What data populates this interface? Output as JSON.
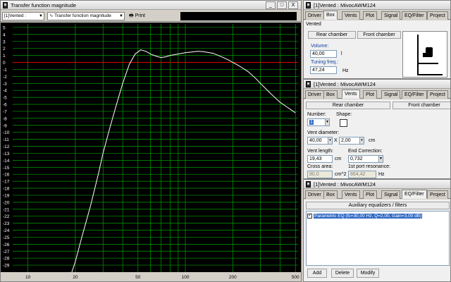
{
  "graph_window": {
    "title": "Transfer function magnitude",
    "toolbar": {
      "project_select": "[1]Vented :",
      "plot_select": "Transfer function magnitude",
      "print_label": "Print"
    },
    "window_buttons": {
      "minimize": "_",
      "maximize": "□",
      "close": "X"
    }
  },
  "box_window": {
    "title": "[1]Vented : MivocAWM124",
    "tabs": [
      "Driver",
      "Box",
      "Vents",
      "Plot",
      "Signal",
      "EQ/Filter",
      "Project"
    ],
    "active_tab": "Box",
    "box_name": "Vented",
    "rear_chamber_btn": "Rear chamber",
    "front_chamber_btn": "Front chamber",
    "volume_label": "Volume:",
    "volume_value": "40,00",
    "volume_unit": "l",
    "tuning_label": "Tuning freq.:",
    "tuning_value": "47,24",
    "tuning_unit": "Hz"
  },
  "vents_window": {
    "title": "[1]Vented : MivocAWM124",
    "tabs": [
      "Driver",
      "Box",
      "Vents",
      "Plot",
      "Signal",
      "EQ/Filter",
      "Project"
    ],
    "active_tab": "Vents",
    "rear_chamber": "Rear chamber",
    "front_chamber": "Front chamber",
    "number_label": "Number:",
    "number_value": "1",
    "shape_label": "Shape:",
    "diameter_label": "Vent diameter:",
    "diameter_value": "40,00",
    "times": "X",
    "count_value": "2,00",
    "cm_unit": "cm",
    "length_label": "Vent length:",
    "length_value": "19,43",
    "end_corr_label": "End Correction:",
    "end_corr_value": "0,732",
    "cross_label": "Cross area:",
    "cross_value": "80,0",
    "cross_unit": "cm^2",
    "port_res_label": "1st port resonance:",
    "port_res_value": "864,42",
    "port_res_unit": "Hz"
  },
  "eq_window": {
    "title": "[1]Vented : MivocAWM124",
    "tabs": [
      "Driver",
      "Box",
      "Vents",
      "Plot",
      "Signal",
      "EQ/Filter",
      "Project"
    ],
    "active_tab": "EQ/Filter",
    "section_title": "Auxiliary equalizers / filters",
    "filter_item": "Parametric EQ (fc=30,00 Hz, Q=2,00, Gain=3,00 dB)",
    "add_btn": "Add",
    "delete_btn": "Delete",
    "modify_btn": "Modify"
  },
  "chart_data": {
    "type": "line",
    "x_scale": "log",
    "xlim": [
      8,
      520
    ],
    "ylim": [
      -30,
      5.5
    ],
    "y_ticks": [
      5,
      4,
      3,
      2,
      1,
      0,
      -1,
      -2,
      -3,
      -4,
      -5,
      -6,
      -7,
      -8,
      -9,
      -10,
      -11,
      -12,
      -13,
      -14,
      -15,
      -16,
      -17,
      -18,
      -19,
      -20,
      -21,
      -22,
      -23,
      -24,
      -25,
      -26,
      -27,
      -28,
      -29
    ],
    "x_ticks": [
      10,
      20,
      30,
      40,
      50,
      60,
      70,
      80,
      90,
      100,
      200,
      300,
      400,
      500
    ],
    "x_tick_labels": {
      "10": "10",
      "20": "20",
      "50": "50",
      "100": "100",
      "200": "200",
      "500": "500"
    },
    "reference_line": 0,
    "series": [
      {
        "color": "#ffffff",
        "x": [
          19,
          20,
          22,
          25,
          28,
          30,
          33,
          36,
          40,
          44,
          48,
          52,
          56,
          60,
          65,
          70,
          75,
          80,
          90,
          100,
          110,
          120,
          130,
          150,
          170,
          190,
          200,
          220,
          250,
          280,
          300,
          350,
          400,
          450,
          500
        ],
        "y": [
          -30,
          -28.5,
          -25,
          -20.5,
          -16,
          -13,
          -9.5,
          -6.5,
          -3,
          -0.3,
          1.2,
          1.8,
          1.6,
          1.2,
          0.9,
          0.7,
          0.8,
          1.0,
          1.2,
          1.4,
          1.5,
          1.6,
          1.55,
          1.3,
          0.8,
          0.3,
          0,
          -0.5,
          -1.3,
          -2.3,
          -3.0,
          -4.5,
          -5.7,
          -6.5,
          -7.2
        ]
      }
    ]
  }
}
